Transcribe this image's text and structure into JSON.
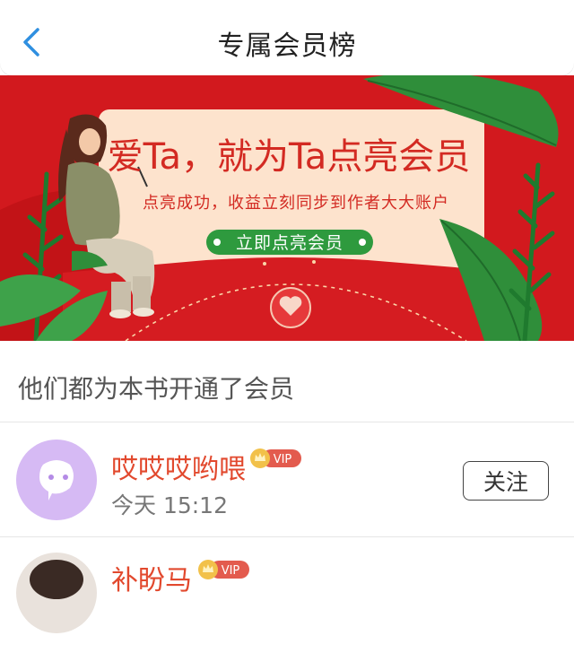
{
  "header": {
    "title": "专属会员榜",
    "back_icon": "chevron-left-icon"
  },
  "banner": {
    "headline": "爱Ta，就为Ta点亮会员",
    "subtext": "点亮成功，收益立刻同步到作者大大账户",
    "cta_label": "立即点亮会员",
    "colors": {
      "background": "#d2191e",
      "card": "#fde3cd",
      "cta": "#2e9a3e",
      "headline": "#d32a22"
    }
  },
  "section": {
    "title": "他们都为本书开通了会员"
  },
  "members": [
    {
      "name": "哎哎哎哟喂",
      "badge": "VIP",
      "time": "今天 15:12",
      "follow_label": "关注"
    },
    {
      "name": "补盼马",
      "badge": "VIP"
    }
  ],
  "colors": {
    "accent_blue": "#2f8fe0",
    "name_orange": "#e2492e",
    "vip_red": "#e35b4e"
  }
}
